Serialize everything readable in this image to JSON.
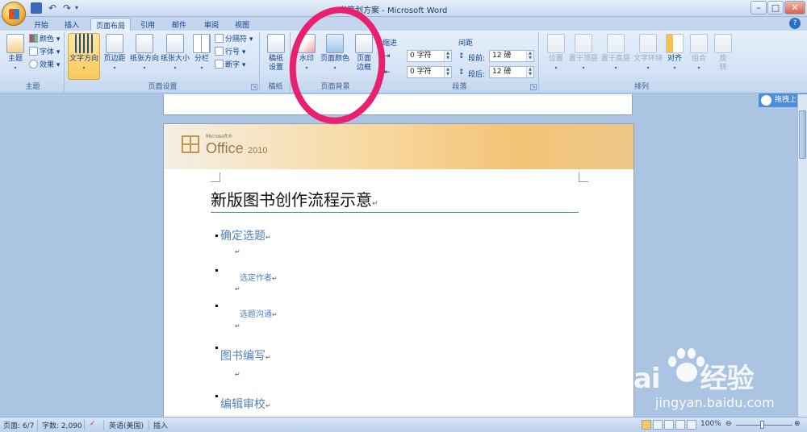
{
  "window": {
    "title": "书策划方案 - Microsoft Word"
  },
  "tabs": [
    {
      "label": "开始"
    },
    {
      "label": "插入"
    },
    {
      "label": "页面布局"
    },
    {
      "label": "引用"
    },
    {
      "label": "邮件"
    },
    {
      "label": "审阅"
    },
    {
      "label": "视图"
    }
  ],
  "ribbon": {
    "theme_group": {
      "label": "主题",
      "theme_btn": "主题",
      "colors": "颜色",
      "fonts": "字体",
      "effects": "效果"
    },
    "page_setup": {
      "label": "页面设置",
      "text_direction": "文字方向",
      "margins": "页边距",
      "orientation": "纸张方向",
      "size": "纸张大小",
      "columns": "分栏",
      "breaks": "分隔符",
      "line_numbers": "行号",
      "hyphenation": "断字"
    },
    "manuscript": {
      "label": "稿纸",
      "btn_line1": "稿纸",
      "btn_line2": "设置"
    },
    "page_background": {
      "label": "页面背景",
      "watermark": "水印",
      "page_color": "页面颜色",
      "border_line1": "页面",
      "border_line2": "边框"
    },
    "paragraph": {
      "label": "段落",
      "indent_title": "缩进",
      "spacing_title": "间距",
      "indent_left": "0 字符",
      "indent_right": "0 字符",
      "before_label": "段前:",
      "before_value": "12 磅",
      "after_label": "段后:",
      "after_value": "12 磅"
    },
    "arrange": {
      "label": "排列",
      "position": "位置",
      "bring_front": "置于顶层",
      "send_back": "置于底层",
      "wrap": "文字环绕",
      "align": "对齐",
      "group": "组合",
      "rotate_line1": "旋",
      "rotate_line2": "转"
    }
  },
  "side_button": {
    "label": "拖拽上"
  },
  "document": {
    "header_small": "Microsoft®",
    "header_office": "Office",
    "header_year": "2010",
    "title": "新版图书创作流程示意",
    "items": [
      {
        "text": "确定选题"
      },
      {
        "text": "选定作者"
      },
      {
        "text": "选题沟通"
      },
      {
        "text": "图书编写"
      },
      {
        "text": "编辑审校"
      }
    ]
  },
  "status_bar": {
    "page": "页面: 6/7",
    "words": "字数: 2,090",
    "language": "英语(美国)",
    "mode": "插入",
    "zoom": "100%"
  },
  "watermark": {
    "brand": "Bai",
    "brand_cn": "经验",
    "url": "jingyan.baidu.com"
  }
}
